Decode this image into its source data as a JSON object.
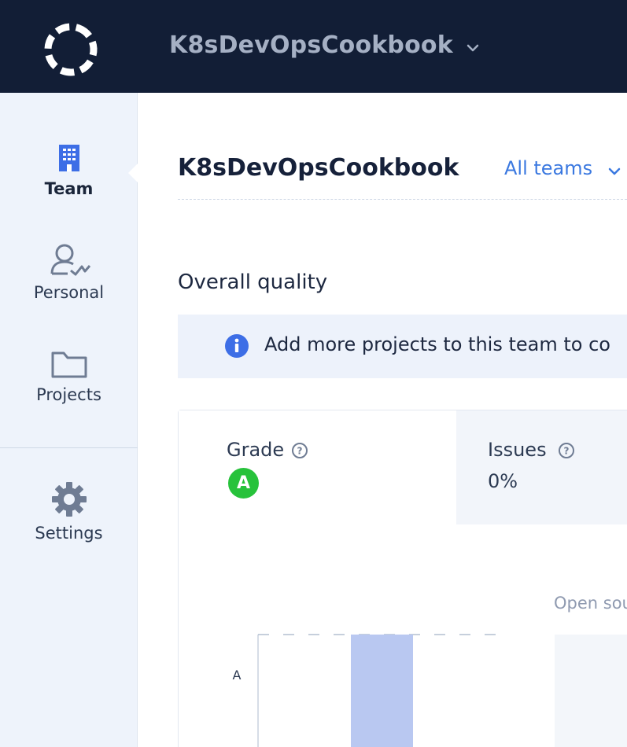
{
  "topbar": {
    "org_name": "K8sDevOpsCookbook",
    "logo_icon": "circle-dashes-logo",
    "chevron_icon": "chevron-down-icon",
    "background": "#121e36"
  },
  "sidebar": {
    "items": [
      {
        "id": "team",
        "label": "Team",
        "icon": "building-icon",
        "active": true
      },
      {
        "id": "personal",
        "label": "Personal",
        "icon": "user-check-icon",
        "active": false
      },
      {
        "id": "projects",
        "label": "Projects",
        "icon": "folder-icon",
        "active": false
      },
      {
        "id": "settings",
        "label": "Settings",
        "icon": "gear-icon",
        "active": false
      }
    ]
  },
  "main": {
    "title": "K8sDevOpsCookbook",
    "team_select": "All teams",
    "section_title": "Overall quality",
    "info_banner": {
      "icon": "info-icon",
      "text": "Add more projects to this team to co"
    },
    "metrics": {
      "grade": {
        "label": "Grade",
        "value": "A",
        "color": "#27c23b"
      },
      "issues": {
        "label": "Issues",
        "value": "0%"
      }
    },
    "chart_caption": "Open sou"
  },
  "chart_data": {
    "type": "bar",
    "categories": [
      ""
    ],
    "values": [
      "A"
    ],
    "yticks": [
      "A"
    ],
    "bar_color": "#b9c8f1"
  }
}
